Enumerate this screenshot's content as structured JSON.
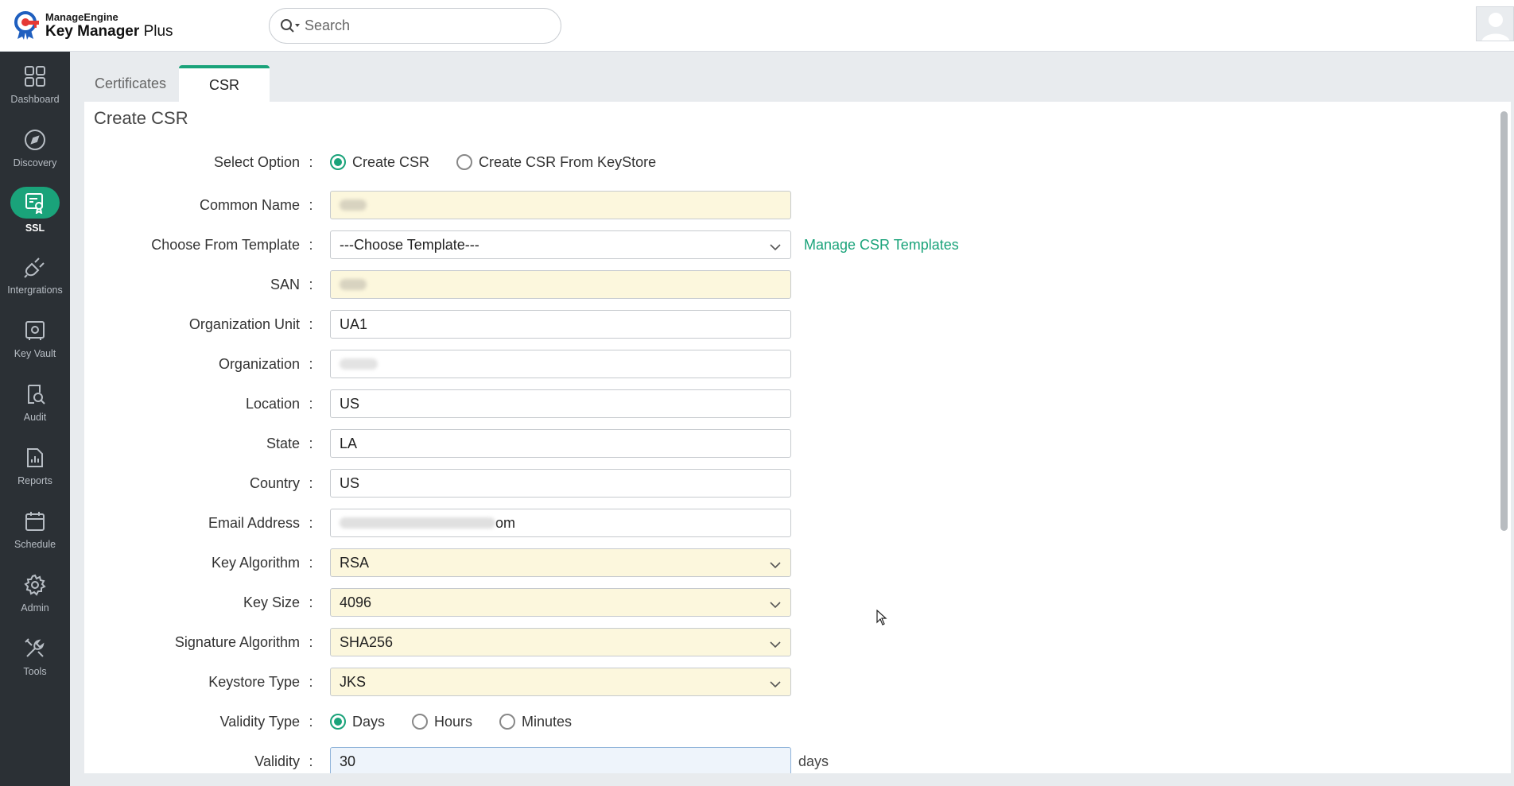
{
  "header": {
    "brand": "ManageEngine",
    "product_prefix": "Key Manager",
    "product_suffix": "Plus",
    "search_placeholder": "Search"
  },
  "sidebar": {
    "items": [
      {
        "label": "Dashboard",
        "icon": "dashboard-icon"
      },
      {
        "label": "Discovery",
        "icon": "compass-icon"
      },
      {
        "label": "SSL",
        "icon": "certificate-icon",
        "active": true
      },
      {
        "label": "Intergrations",
        "icon": "plug-icon"
      },
      {
        "label": "Key Vault",
        "icon": "vault-icon"
      },
      {
        "label": "Audit",
        "icon": "audit-icon"
      },
      {
        "label": "Reports",
        "icon": "reports-icon"
      },
      {
        "label": "Schedule",
        "icon": "calendar-icon"
      },
      {
        "label": "Admin",
        "icon": "gear-icon"
      },
      {
        "label": "Tools",
        "icon": "tools-icon"
      }
    ]
  },
  "tabs": [
    {
      "label": "Certificates",
      "active": false
    },
    {
      "label": "CSR",
      "active": true
    }
  ],
  "form": {
    "title": "Create CSR",
    "select_option": {
      "label": "Select Option",
      "options": [
        "Create CSR",
        "Create CSR From KeyStore"
      ],
      "selected": "Create CSR"
    },
    "common_name": {
      "label": "Common Name",
      "value": ""
    },
    "template": {
      "label": "Choose From Template",
      "value": "---Choose Template---",
      "link": "Manage CSR Templates"
    },
    "san": {
      "label": "SAN",
      "value": ""
    },
    "org_unit": {
      "label": "Organization Unit",
      "value": "UA1"
    },
    "organization": {
      "label": "Organization",
      "value": ""
    },
    "location": {
      "label": "Location",
      "value": "US"
    },
    "state": {
      "label": "State",
      "value": "LA"
    },
    "country": {
      "label": "Country",
      "value": "US"
    },
    "email": {
      "label": "Email Address",
      "value_suffix": "om"
    },
    "key_algorithm": {
      "label": "Key Algorithm",
      "value": "RSA"
    },
    "key_size": {
      "label": "Key Size",
      "value": "4096"
    },
    "signature_algorithm": {
      "label": "Signature Algorithm",
      "value": "SHA256"
    },
    "keystore_type": {
      "label": "Keystore Type",
      "value": "JKS"
    },
    "validity_type": {
      "label": "Validity Type",
      "options": [
        "Days",
        "Hours",
        "Minutes"
      ],
      "selected": "Days"
    },
    "validity": {
      "label": "Validity",
      "value": "30",
      "unit": "days"
    }
  },
  "colors": {
    "accent": "#1aa37a",
    "sidebar": "#2b3035",
    "highlight": "#fcf7dd"
  }
}
